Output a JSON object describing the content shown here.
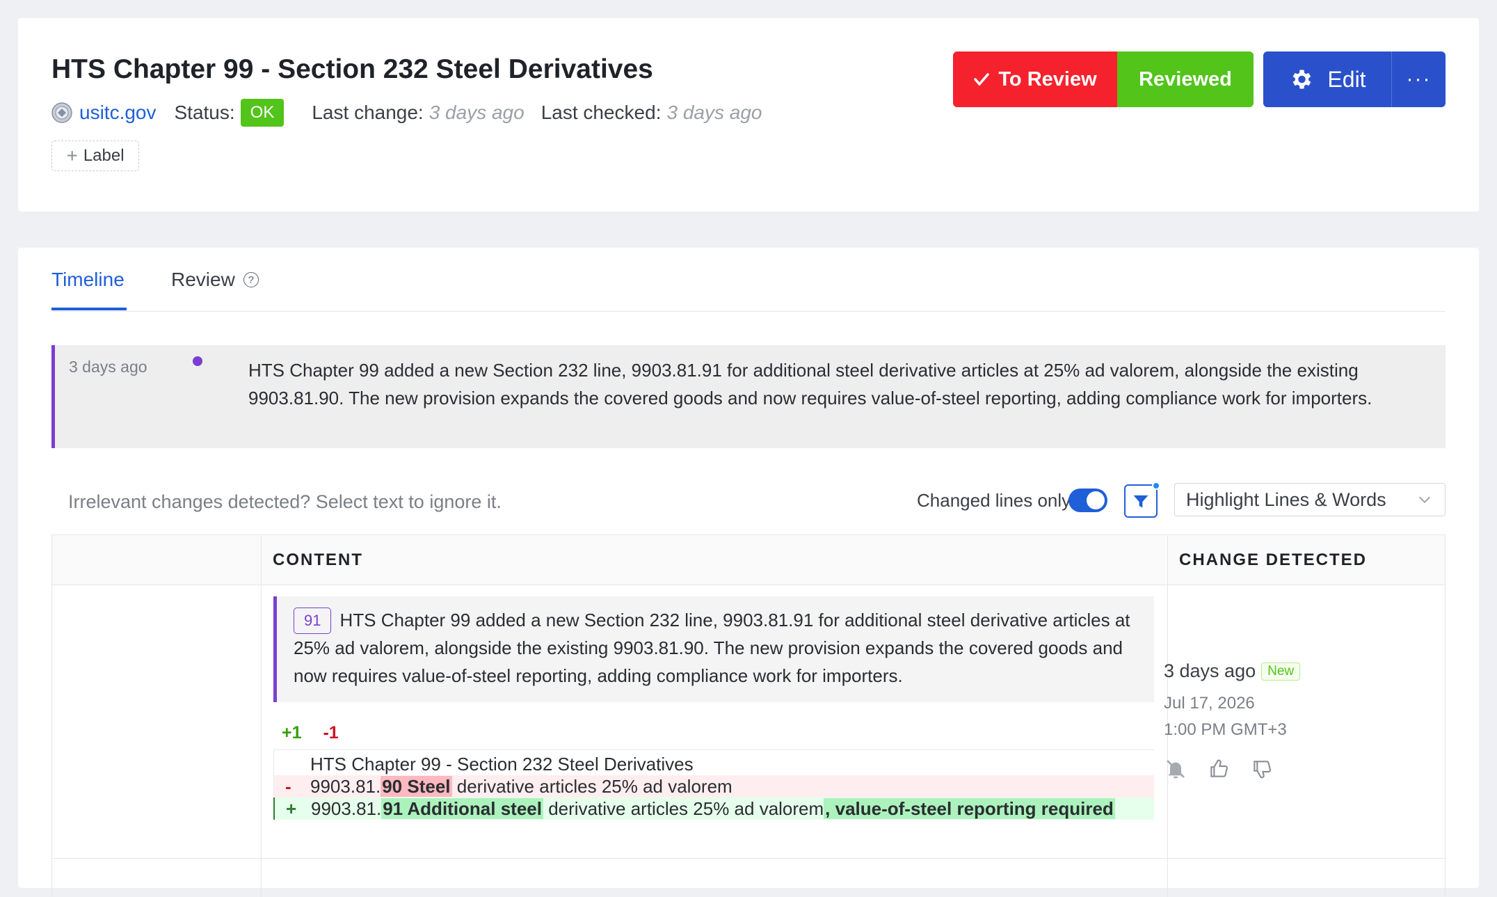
{
  "header": {
    "title": "HTS Chapter 99 - Section 232 Steel Derivatives",
    "site": "usitc.gov",
    "status_label": "Status:",
    "status_value": "OK",
    "last_change_label": "Last change:",
    "last_change_value": "3 days ago",
    "last_checked_label": "Last checked:",
    "last_checked_value": "3 days ago",
    "label_button": "Label",
    "to_review_label": "To Review",
    "reviewed_label": "Reviewed",
    "edit_label": "Edit",
    "more_label": "···"
  },
  "tabs": [
    {
      "label": "Timeline",
      "active": true
    },
    {
      "label": "Review",
      "active": false
    }
  ],
  "summary": {
    "time": "3 days ago",
    "text": "HTS Chapter 99 added a new Section 232 line, 9903.81.91 for additional steel derivative articles at 25% ad valorem, alongside the existing 9903.81.90. The new provision expands the covered goods and now requires value-of-steel reporting, adding compliance work for importers."
  },
  "controls": {
    "ignore_hint": "Irrelevant changes detected? Select text to ignore it.",
    "changed_lines_label": "Changed lines only",
    "changed_lines_on": true,
    "highlight_mode": "Highlight Lines & Words"
  },
  "table": {
    "headers": {
      "content": "CONTENT",
      "change": "CHANGE DETECTED"
    },
    "row": {
      "badge": "91",
      "content_text": "HTS Chapter 99 added a new Section 232 line, 9903.81.91 for additional steel derivative articles at 25% ad valorem, alongside the existing 9903.81.90. The new provision expands the covered goods and now requires value-of-steel reporting, adding compliance work for importers.",
      "added_count": "+1",
      "removed_count": "-1",
      "diff": {
        "context": "HTS Chapter 99 - Section 232 Steel Derivatives",
        "del_sign": "-",
        "del_prefix": "9903.81.",
        "del_hl": "90  Steel",
        "del_suffix": " derivative articles  25% ad valorem",
        "add_sign": "+",
        "add_prefix": "9903.81.",
        "add_hl1": "91  Additional steel",
        "add_mid": " derivative articles  25% ad valorem",
        "add_hl2": ", value-of-steel reporting required"
      },
      "change": {
        "ago": "3 days ago",
        "tag": "New",
        "date": "Jul 17, 2026",
        "time": "1:00 PM GMT+3"
      }
    }
  },
  "colors": {
    "accent": "#1f5fd8",
    "to_review": "#f5222d",
    "reviewed": "#52c41a",
    "edit": "#2b50cc",
    "marker": "#7a3fd0"
  }
}
